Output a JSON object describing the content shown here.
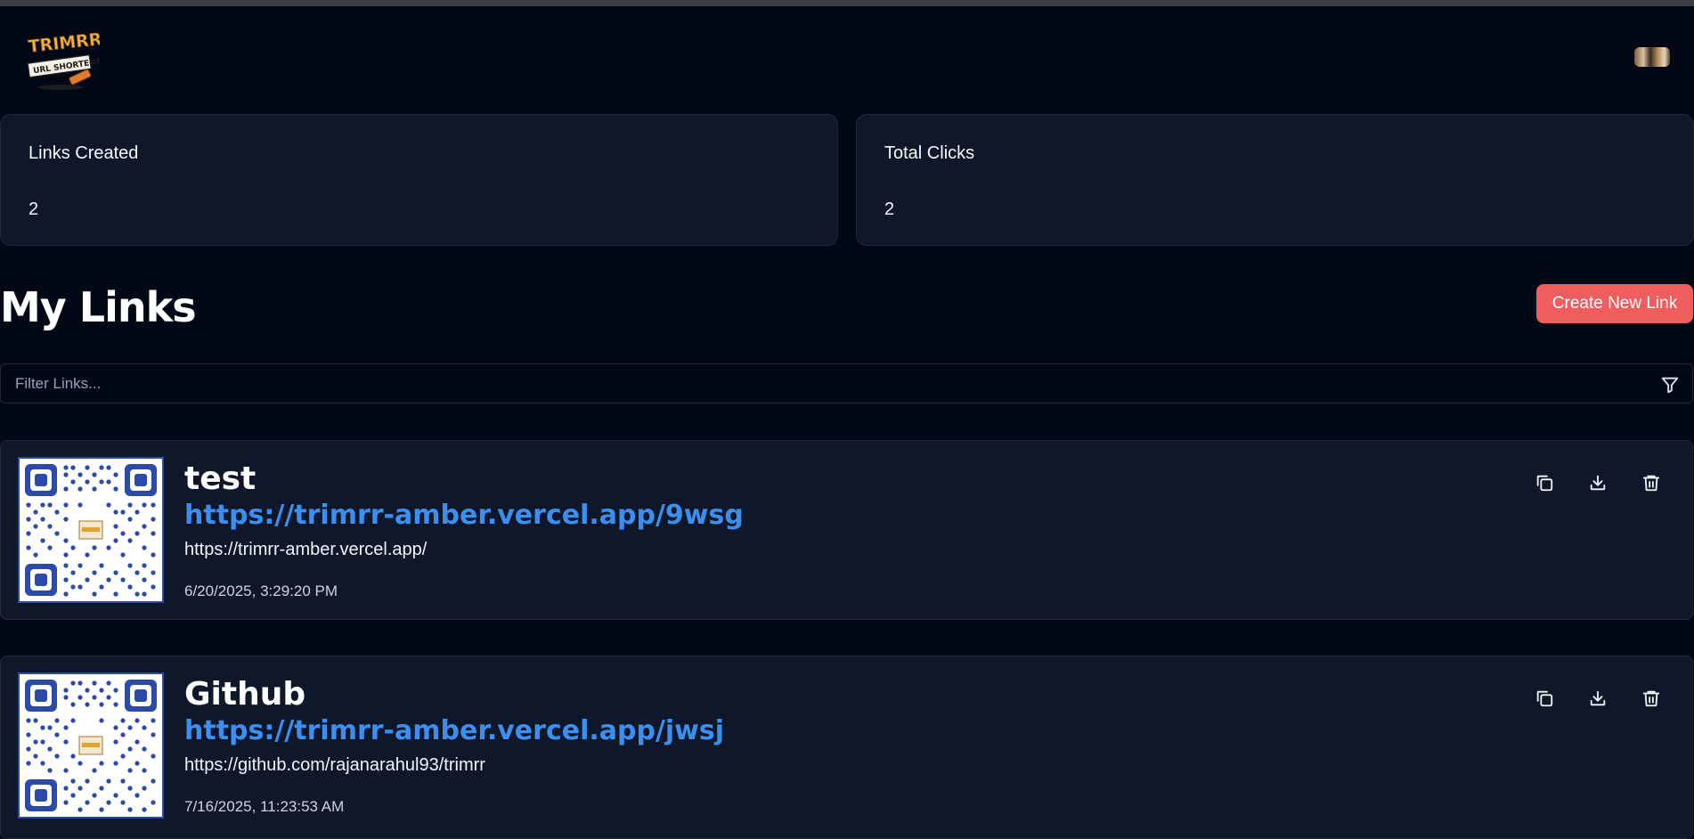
{
  "header": {
    "logo_icon": "trimmr-logo",
    "avatar_icon": "user-avatar"
  },
  "stats": [
    {
      "label": "Links Created",
      "value": "2"
    },
    {
      "label": "Total Clicks",
      "value": "2"
    }
  ],
  "main": {
    "title": "My Links",
    "create_button_label": "Create New Link",
    "filter_placeholder": "Filter Links...",
    "filter_icon": "filter-icon"
  },
  "links": [
    {
      "title": "test",
      "short_url": "https://trimrr-amber.vercel.app/9wsg",
      "original_url": "https://trimrr-amber.vercel.app/",
      "created": "6/20/2025, 3:29:20 PM"
    },
    {
      "title": "Github",
      "short_url": "https://trimrr-amber.vercel.app/jwsj",
      "original_url": "https://github.com/rajanarahul93/trimrr",
      "created": "7/16/2025, 11:23:53 AM"
    }
  ],
  "colors": {
    "background": "#030817",
    "card": "#0f172a",
    "accent": "#f05d5e",
    "link": "#3b8ff0"
  }
}
